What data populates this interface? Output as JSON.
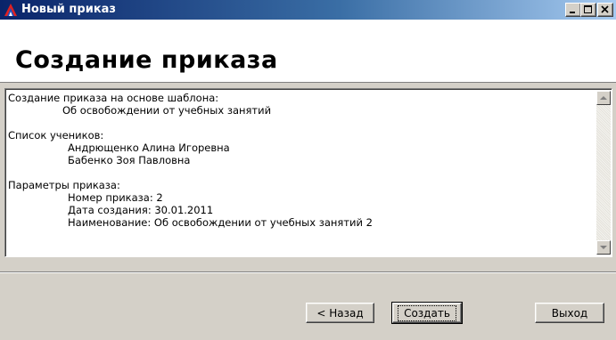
{
  "window": {
    "title": "Новый приказ"
  },
  "header": {
    "title": "Создание приказа"
  },
  "content": {
    "template_heading": "Создание приказа на основе шаблона:",
    "template_name": "Об освобождении от учебных занятий",
    "students_heading": "Список учеников:",
    "students": [
      "Андрющенко Алина Игоревна",
      "Бабенко Зоя Павловна"
    ],
    "params_heading": "Параметры приказа:",
    "params": [
      "Номер приказа: 2",
      "Дата создания: 30.01.2011",
      "Наименование: Об освобождении от учебных занятий 2"
    ]
  },
  "buttons": {
    "back": "< Назад",
    "create": "Создать",
    "exit": "Выход"
  },
  "colors": {
    "titlebar_start": "#0a246a",
    "titlebar_end": "#a6caf0",
    "dialog_bg": "#d4d0c8"
  }
}
